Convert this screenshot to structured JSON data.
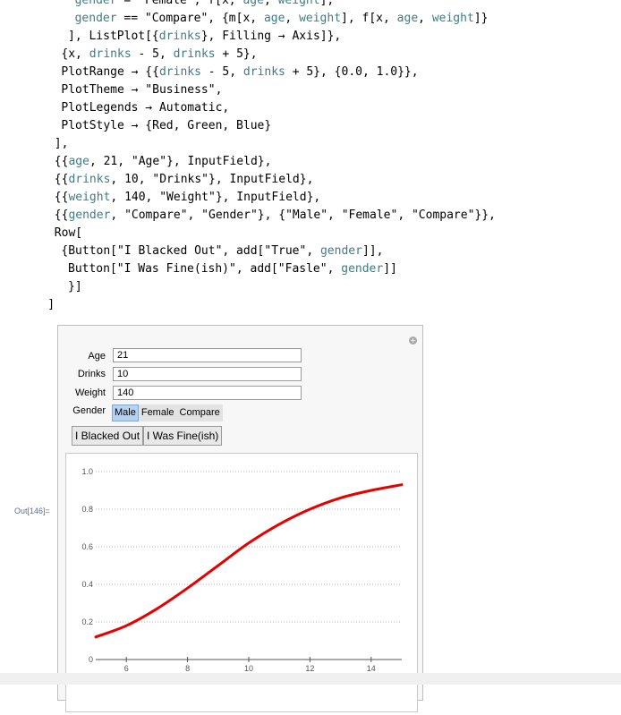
{
  "code_lines": [
    {
      "indent": "           ",
      "parts": [
        [
          "v",
          "gender"
        ],
        [
          "t",
          " = \"Female\", "
        ],
        [
          "t",
          "f[x, "
        ],
        [
          "v",
          "age"
        ],
        [
          "t",
          ", "
        ],
        [
          "v",
          "weight"
        ],
        [
          "t",
          "],"
        ]
      ]
    },
    {
      "indent": "           ",
      "parts": [
        [
          "v",
          "gender"
        ],
        [
          "t",
          " == \"Compare\", {m[x, "
        ],
        [
          "v",
          "age"
        ],
        [
          "t",
          ", "
        ],
        [
          "v",
          "weight"
        ],
        [
          "t",
          "], f[x, "
        ],
        [
          "v",
          "age"
        ],
        [
          "t",
          ", "
        ],
        [
          "v",
          "weight"
        ],
        [
          "t",
          "]}"
        ]
      ]
    },
    {
      "indent": "          ",
      "parts": [
        [
          "t",
          "], ListPlot[{"
        ],
        [
          "v",
          "drinks"
        ],
        [
          "t",
          "}, Filling → Axis]},"
        ]
      ]
    },
    {
      "indent": "         ",
      "parts": [
        [
          "t",
          "{x, "
        ],
        [
          "v",
          "drinks"
        ],
        [
          "t",
          " - 5, "
        ],
        [
          "v",
          "drinks"
        ],
        [
          "t",
          " + 5},"
        ]
      ]
    },
    {
      "indent": "         ",
      "parts": [
        [
          "t",
          "PlotRange → {{"
        ],
        [
          "v",
          "drinks"
        ],
        [
          "t",
          " - 5, "
        ],
        [
          "v",
          "drinks"
        ],
        [
          "t",
          " + 5}, {0.0, 1.0}},"
        ]
      ]
    },
    {
      "indent": "         ",
      "parts": [
        [
          "t",
          "PlotTheme → \"Business\","
        ]
      ]
    },
    {
      "indent": "         ",
      "parts": [
        [
          "t",
          "PlotLegends → Automatic,"
        ]
      ]
    },
    {
      "indent": "         ",
      "parts": [
        [
          "t",
          "PlotStyle → {Red, Green, Blue}"
        ]
      ]
    },
    {
      "indent": "        ",
      "parts": [
        [
          "t",
          "],"
        ]
      ]
    },
    {
      "indent": "        ",
      "parts": [
        [
          "t",
          "{{"
        ],
        [
          "v",
          "age"
        ],
        [
          "t",
          ", 21, \"Age\"}, InputField},"
        ]
      ]
    },
    {
      "indent": "        ",
      "parts": [
        [
          "t",
          "{{"
        ],
        [
          "v",
          "drinks"
        ],
        [
          "t",
          ", 10, \"Drinks\"}, InputField},"
        ]
      ]
    },
    {
      "indent": "        ",
      "parts": [
        [
          "t",
          "{{"
        ],
        [
          "v",
          "weight"
        ],
        [
          "t",
          ", 140, \"Weight\"}, InputField},"
        ]
      ]
    },
    {
      "indent": "        ",
      "parts": [
        [
          "t",
          "{{"
        ],
        [
          "v",
          "gender"
        ],
        [
          "t",
          ", \"Compare\", \"Gender\"}, {\"Male\", \"Female\", \"Compare\"}},"
        ]
      ]
    },
    {
      "indent": "        ",
      "parts": [
        [
          "t",
          "Row["
        ]
      ]
    },
    {
      "indent": "         ",
      "parts": [
        [
          "t",
          "{Button[\"I Blacked Out\", add[\"True\", "
        ],
        [
          "v",
          "gender"
        ],
        [
          "t",
          "]],"
        ]
      ]
    },
    {
      "indent": "          ",
      "parts": [
        [
          "t",
          "Button[\"I Was Fine(ish)\", add[\"Fasle\", "
        ],
        [
          "v",
          "gender"
        ],
        [
          "t",
          "]]"
        ]
      ]
    },
    {
      "indent": "          ",
      "parts": [
        [
          "t",
          "}]"
        ]
      ]
    },
    {
      "indent": "       ",
      "parts": [
        [
          "t",
          "]"
        ]
      ]
    }
  ],
  "out_label": "Out[146]=",
  "form": {
    "age_label": "Age",
    "age_value": "21",
    "drinks_label": "Drinks",
    "drinks_value": "10",
    "weight_label": "Weight",
    "weight_value": "140",
    "gender_label": "Gender",
    "gender_options": [
      "Male",
      "Female",
      "Compare"
    ],
    "gender_selected": "Male",
    "button1": "I Blacked Out",
    "button2": "I Was Fine(ish)"
  },
  "chart_data": {
    "type": "line",
    "color": "#e60000",
    "xlim": [
      5,
      15
    ],
    "ylim": [
      0,
      1
    ],
    "x_ticks": [
      "6",
      "8",
      "10",
      "12",
      "14"
    ],
    "y_ticks": [
      "0",
      "0.2",
      "0.4",
      "0.6",
      "0.8",
      "1.0"
    ],
    "grid": "horizontal-dotted",
    "series": [
      {
        "x": [
          5,
          6,
          7,
          8,
          9,
          10,
          11,
          12,
          13,
          14,
          15
        ],
        "y": [
          0.12,
          0.18,
          0.27,
          0.38,
          0.5,
          0.62,
          0.72,
          0.8,
          0.86,
          0.9,
          0.93
        ]
      }
    ]
  }
}
